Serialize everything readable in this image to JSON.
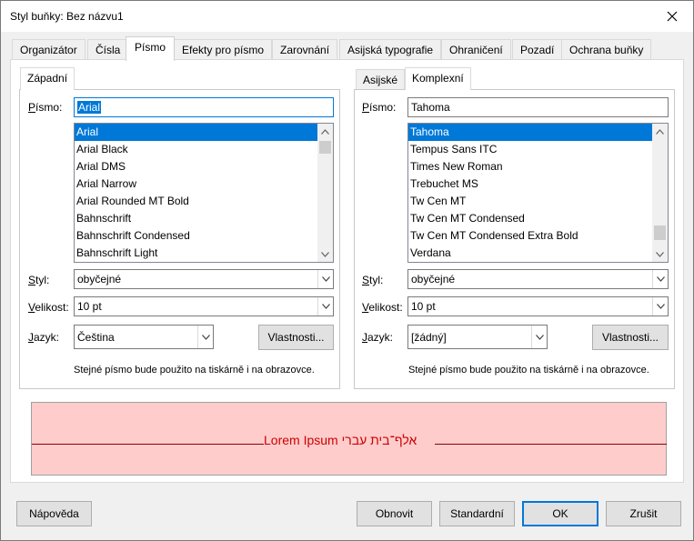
{
  "window": {
    "title": "Styl buňky: Bez názvu1"
  },
  "tabs": [
    {
      "label": "Organizátor"
    },
    {
      "label": "Čísla"
    },
    {
      "label": "Písmo"
    },
    {
      "label": "Efekty pro písmo"
    },
    {
      "label": "Zarovnání"
    },
    {
      "label": "Asijská typografie"
    },
    {
      "label": "Ohraničení"
    },
    {
      "label": "Pozadí"
    },
    {
      "label": "Ochrana buňky"
    }
  ],
  "western": {
    "tab_label": "Západní",
    "font_label": "Písmo:",
    "font_value": "Arial",
    "font_list": [
      "Arial",
      "Arial Black",
      "Arial DMS",
      "Arial Narrow",
      "Arial Rounded MT Bold",
      "Bahnschrift",
      "Bahnschrift Condensed",
      "Bahnschrift Light"
    ],
    "style_label": "Styl:",
    "style_value": "obyčejné",
    "size_label": "Velikost:",
    "size_value": "10 pt",
    "language_label": "Jazyk:",
    "language_value": "Čeština",
    "features_button": "Vlastnosti...",
    "note": "Stejné písmo bude použito na tiskárně i na obrazovce."
  },
  "complex": {
    "tab_asian": "Asijské",
    "tab_label": "Komplexní",
    "font_label": "Písmo:",
    "font_value": "Tahoma",
    "font_list": [
      "Tahoma",
      "Tempus Sans ITC",
      "Times New Roman",
      "Trebuchet MS",
      "Tw Cen MT",
      "Tw Cen MT Condensed",
      "Tw Cen MT Condensed Extra Bold",
      "Verdana"
    ],
    "style_label": "Styl:",
    "style_value": "obyčejné",
    "size_label": "Velikost:",
    "size_value": "10 pt",
    "language_label": "Jazyk:",
    "language_value": "[žádný]",
    "features_button": "Vlastnosti...",
    "note": "Stejné písmo bude použito na tiskárně i na obrazovce."
  },
  "preview": {
    "text": "Lorem Ipsum     אלף־בית עברי"
  },
  "buttons": {
    "help": "Nápověda",
    "reset": "Obnovit",
    "standard": "Standardní",
    "ok": "OK",
    "cancel": "Zrušit"
  }
}
